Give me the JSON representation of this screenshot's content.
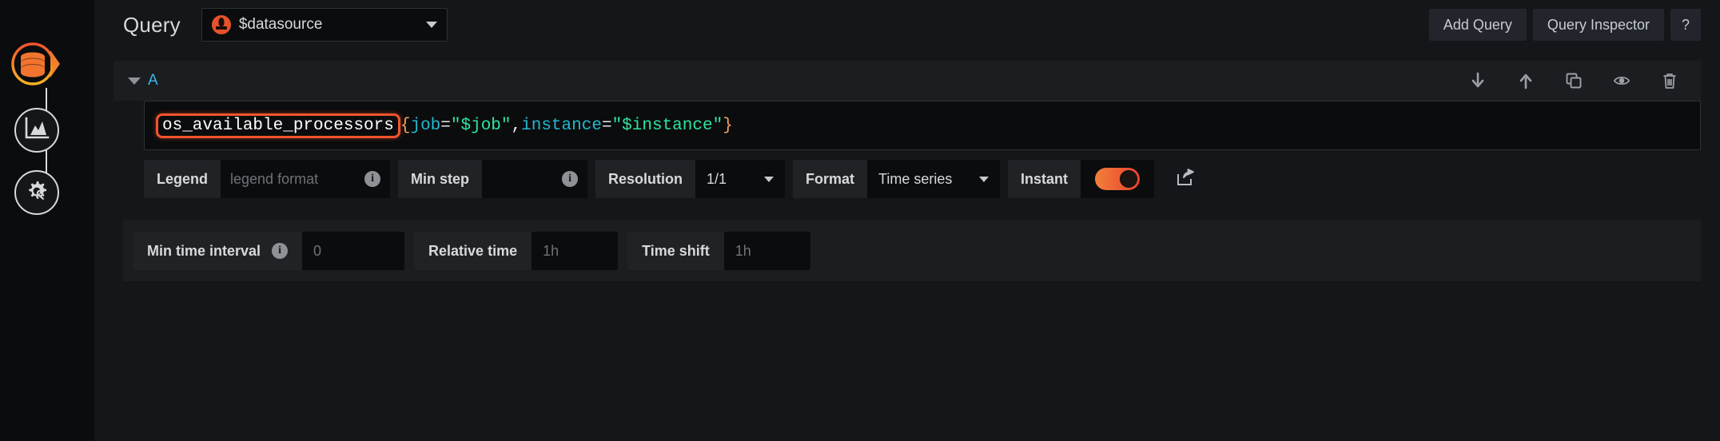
{
  "header": {
    "title": "Query",
    "datasource": {
      "label": "$datasource",
      "icon": "prometheus-logo",
      "caret_icon": "chevron-down-icon"
    },
    "actions": [
      {
        "label": "Add Query",
        "name": "add-query-button"
      },
      {
        "label": "Query Inspector",
        "name": "query-inspector-button"
      },
      {
        "label": "?",
        "name": "help-button"
      }
    ]
  },
  "query_row": {
    "ref_id": "A",
    "collapse_icon": "chevron-down-icon",
    "row_icons": [
      {
        "name": "move-down-icon",
        "glyph": "arrow-down"
      },
      {
        "name": "move-up-icon",
        "glyph": "arrow-up"
      },
      {
        "name": "duplicate-query-icon",
        "glyph": "copy"
      },
      {
        "name": "toggle-visibility-icon",
        "glyph": "eye"
      },
      {
        "name": "remove-query-icon",
        "glyph": "trash"
      }
    ],
    "expression": {
      "metric": "os_available_processors",
      "open_brace": "{",
      "label1": "job",
      "eq1": "=",
      "value1": "\"$job\"",
      "comma": ",",
      "label2": "instance",
      "eq2": "=",
      "value2": "\"$instance\"",
      "close_brace": "}"
    },
    "options": {
      "legend_label": "Legend",
      "legend_placeholder": "legend format",
      "legend_value": "",
      "legend_info_icon": "info-icon",
      "min_step_label": "Min step",
      "min_step_value": "",
      "min_step_info_icon": "info-icon",
      "resolution_label": "Resolution",
      "resolution_value": "1/1",
      "format_label": "Format",
      "format_value": "Time series",
      "instant_label": "Instant",
      "instant_on": true,
      "share_icon": "external-link-icon"
    }
  },
  "bottom_options": {
    "min_time_interval_label": "Min time interval",
    "min_time_interval_placeholder": "0",
    "min_time_interval_info_icon": "info-icon",
    "relative_time_label": "Relative time",
    "relative_time_placeholder": "1h",
    "time_shift_label": "Time shift",
    "time_shift_placeholder": "1h"
  },
  "sidebar": {
    "items": [
      {
        "name": "sidebar-datasource-node",
        "icon": "database-icon",
        "active": true
      },
      {
        "name": "sidebar-visualization-node",
        "icon": "graph-area-icon",
        "active": false
      },
      {
        "name": "sidebar-settings-node",
        "icon": "gear-wrench-icon",
        "active": false
      }
    ]
  },
  "colors": {
    "accent_orange": "#f2542d",
    "link_blue": "#3cb7e8",
    "string_green": "#2ee59d",
    "label_cyan": "#22b8cf",
    "brace_orange": "#f2a25c",
    "panel_bg": "#141619",
    "input_bg": "#0b0c0e",
    "row_bg": "#1b1d21"
  }
}
